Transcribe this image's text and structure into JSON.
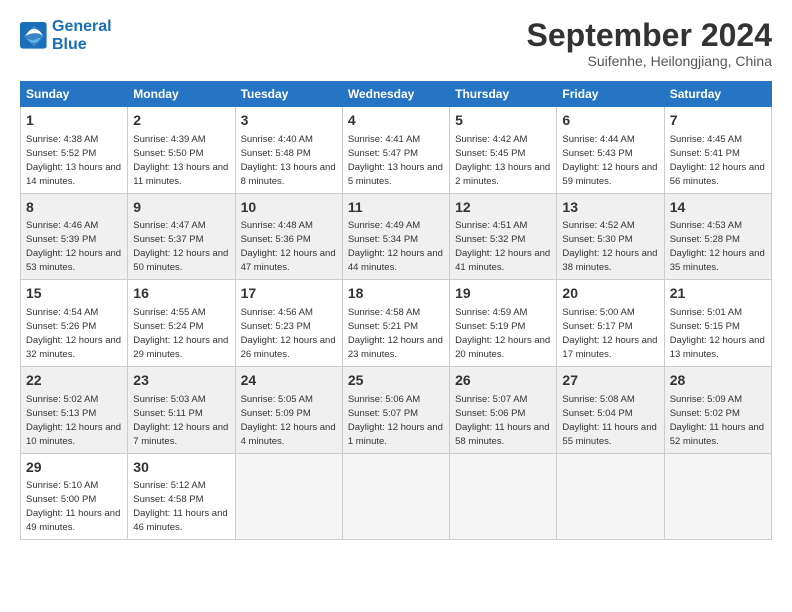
{
  "logo": {
    "line1": "General",
    "line2": "Blue"
  },
  "title": "September 2024",
  "subtitle": "Suifenhe, Heilongjiang, China",
  "days_header": [
    "Sunday",
    "Monday",
    "Tuesday",
    "Wednesday",
    "Thursday",
    "Friday",
    "Saturday"
  ],
  "weeks": [
    [
      {
        "day": "1",
        "info": "Sunrise: 4:38 AM\nSunset: 5:52 PM\nDaylight: 13 hours and 14 minutes."
      },
      {
        "day": "2",
        "info": "Sunrise: 4:39 AM\nSunset: 5:50 PM\nDaylight: 13 hours and 11 minutes."
      },
      {
        "day": "3",
        "info": "Sunrise: 4:40 AM\nSunset: 5:48 PM\nDaylight: 13 hours and 8 minutes."
      },
      {
        "day": "4",
        "info": "Sunrise: 4:41 AM\nSunset: 5:47 PM\nDaylight: 13 hours and 5 minutes."
      },
      {
        "day": "5",
        "info": "Sunrise: 4:42 AM\nSunset: 5:45 PM\nDaylight: 13 hours and 2 minutes."
      },
      {
        "day": "6",
        "info": "Sunrise: 4:44 AM\nSunset: 5:43 PM\nDaylight: 12 hours and 59 minutes."
      },
      {
        "day": "7",
        "info": "Sunrise: 4:45 AM\nSunset: 5:41 PM\nDaylight: 12 hours and 56 minutes."
      }
    ],
    [
      {
        "day": "8",
        "info": "Sunrise: 4:46 AM\nSunset: 5:39 PM\nDaylight: 12 hours and 53 minutes."
      },
      {
        "day": "9",
        "info": "Sunrise: 4:47 AM\nSunset: 5:37 PM\nDaylight: 12 hours and 50 minutes."
      },
      {
        "day": "10",
        "info": "Sunrise: 4:48 AM\nSunset: 5:36 PM\nDaylight: 12 hours and 47 minutes."
      },
      {
        "day": "11",
        "info": "Sunrise: 4:49 AM\nSunset: 5:34 PM\nDaylight: 12 hours and 44 minutes."
      },
      {
        "day": "12",
        "info": "Sunrise: 4:51 AM\nSunset: 5:32 PM\nDaylight: 12 hours and 41 minutes."
      },
      {
        "day": "13",
        "info": "Sunrise: 4:52 AM\nSunset: 5:30 PM\nDaylight: 12 hours and 38 minutes."
      },
      {
        "day": "14",
        "info": "Sunrise: 4:53 AM\nSunset: 5:28 PM\nDaylight: 12 hours and 35 minutes."
      }
    ],
    [
      {
        "day": "15",
        "info": "Sunrise: 4:54 AM\nSunset: 5:26 PM\nDaylight: 12 hours and 32 minutes."
      },
      {
        "day": "16",
        "info": "Sunrise: 4:55 AM\nSunset: 5:24 PM\nDaylight: 12 hours and 29 minutes."
      },
      {
        "day": "17",
        "info": "Sunrise: 4:56 AM\nSunset: 5:23 PM\nDaylight: 12 hours and 26 minutes."
      },
      {
        "day": "18",
        "info": "Sunrise: 4:58 AM\nSunset: 5:21 PM\nDaylight: 12 hours and 23 minutes."
      },
      {
        "day": "19",
        "info": "Sunrise: 4:59 AM\nSunset: 5:19 PM\nDaylight: 12 hours and 20 minutes."
      },
      {
        "day": "20",
        "info": "Sunrise: 5:00 AM\nSunset: 5:17 PM\nDaylight: 12 hours and 17 minutes."
      },
      {
        "day": "21",
        "info": "Sunrise: 5:01 AM\nSunset: 5:15 PM\nDaylight: 12 hours and 13 minutes."
      }
    ],
    [
      {
        "day": "22",
        "info": "Sunrise: 5:02 AM\nSunset: 5:13 PM\nDaylight: 12 hours and 10 minutes."
      },
      {
        "day": "23",
        "info": "Sunrise: 5:03 AM\nSunset: 5:11 PM\nDaylight: 12 hours and 7 minutes."
      },
      {
        "day": "24",
        "info": "Sunrise: 5:05 AM\nSunset: 5:09 PM\nDaylight: 12 hours and 4 minutes."
      },
      {
        "day": "25",
        "info": "Sunrise: 5:06 AM\nSunset: 5:07 PM\nDaylight: 12 hours and 1 minute."
      },
      {
        "day": "26",
        "info": "Sunrise: 5:07 AM\nSunset: 5:06 PM\nDaylight: 11 hours and 58 minutes."
      },
      {
        "day": "27",
        "info": "Sunrise: 5:08 AM\nSunset: 5:04 PM\nDaylight: 11 hours and 55 minutes."
      },
      {
        "day": "28",
        "info": "Sunrise: 5:09 AM\nSunset: 5:02 PM\nDaylight: 11 hours and 52 minutes."
      }
    ],
    [
      {
        "day": "29",
        "info": "Sunrise: 5:10 AM\nSunset: 5:00 PM\nDaylight: 11 hours and 49 minutes."
      },
      {
        "day": "30",
        "info": "Sunrise: 5:12 AM\nSunset: 4:58 PM\nDaylight: 11 hours and 46 minutes."
      },
      {
        "day": "",
        "info": ""
      },
      {
        "day": "",
        "info": ""
      },
      {
        "day": "",
        "info": ""
      },
      {
        "day": "",
        "info": ""
      },
      {
        "day": "",
        "info": ""
      }
    ]
  ]
}
